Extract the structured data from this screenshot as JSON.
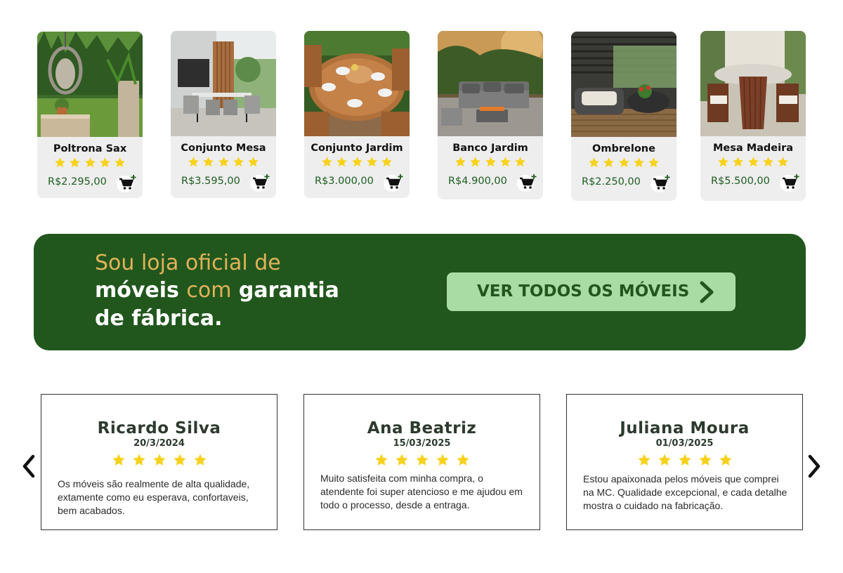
{
  "colors": {
    "brand_green": "#21571d",
    "price_green": "#1e5c21",
    "gold": "#e2b25a",
    "star": "#f7d21c",
    "cta_bg": "#a8dca4",
    "card_bg": "#eeeeee"
  },
  "products": [
    {
      "name": "Poltrona Sax",
      "price": "R$2.295,00",
      "rating": 5,
      "image": "hanging-egg-chair-garden",
      "cart_icon": "add-to-cart-icon"
    },
    {
      "name": "Conjunto Mesa",
      "price": "R$3.595,00",
      "rating": 5,
      "image": "terrace-dining-set",
      "cart_icon": "add-to-cart-icon"
    },
    {
      "name": "Conjunto Jardim",
      "price": "R$3.000,00",
      "rating": 5,
      "image": "round-wood-garden-table",
      "cart_icon": "add-to-cart-icon"
    },
    {
      "name": "Banco Jardim",
      "price": "R$4.900,00",
      "rating": 5,
      "image": "outdoor-sofa-fire-table",
      "cart_icon": "add-to-cart-icon"
    },
    {
      "name": "Ombrelone",
      "price": "R$2.250,00",
      "rating": 5,
      "image": "pergola-wicker-seating",
      "cart_icon": "add-to-cart-icon"
    },
    {
      "name": "Mesa Madeira",
      "price": "R$5.500,00",
      "rating": 5,
      "image": "wood-dining-table-indoor",
      "cart_icon": "add-to-cart-icon"
    }
  ],
  "banner": {
    "line1": "Sou loja oficial de",
    "line2_a": "móveis ",
    "line2_b": "com",
    "line2_c": " garantia",
    "line3": "de fábrica.",
    "cta_label": "VER TODOS OS MÓVEIS",
    "cta_icon": "chevron-right-icon"
  },
  "testimonials": {
    "prev_icon": "chevron-left-icon",
    "next_icon": "chevron-right-icon",
    "items": [
      {
        "name": "Ricardo Silva",
        "date": "20/3/2024",
        "rating": 5,
        "text": "Os móveis são realmente de alta qualidade, extamente como eu esperava, confortaveis, bem acabados."
      },
      {
        "name": "Ana Beatriz",
        "date": "15/03/2025",
        "rating": 5,
        "text": "Muito satisfeita com minha compra, o atendente foi super atencioso e me ajudou em todo o processo, desde a entraga."
      },
      {
        "name": "Juliana Moura",
        "date": "01/03/2025",
        "rating": 5,
        "text": "Estou apaixonada pelos móveis que comprei na MC. Qualidade excepcional, e cada detalhe mostra o cuidado na fabricação."
      }
    ]
  }
}
